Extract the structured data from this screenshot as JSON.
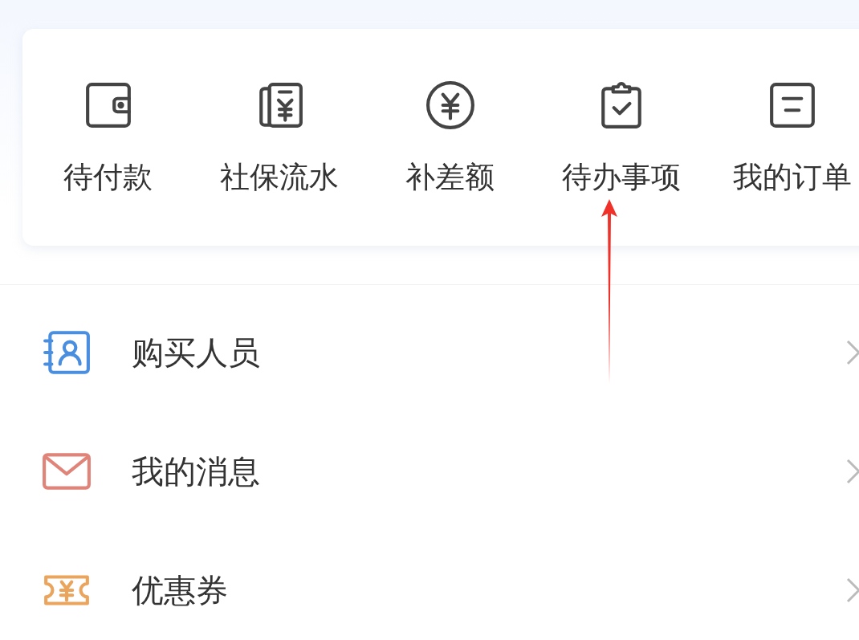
{
  "shortcuts": [
    {
      "label": "待付款"
    },
    {
      "label": "社保流水"
    },
    {
      "label": "补差额"
    },
    {
      "label": "待办事项"
    },
    {
      "label": "我的订单"
    }
  ],
  "menu": [
    {
      "label": "购买人员",
      "color": "#4a8ee0"
    },
    {
      "label": "我的消息",
      "color": "#e0847a"
    },
    {
      "label": "优惠券",
      "color": "#eba45c"
    }
  ]
}
